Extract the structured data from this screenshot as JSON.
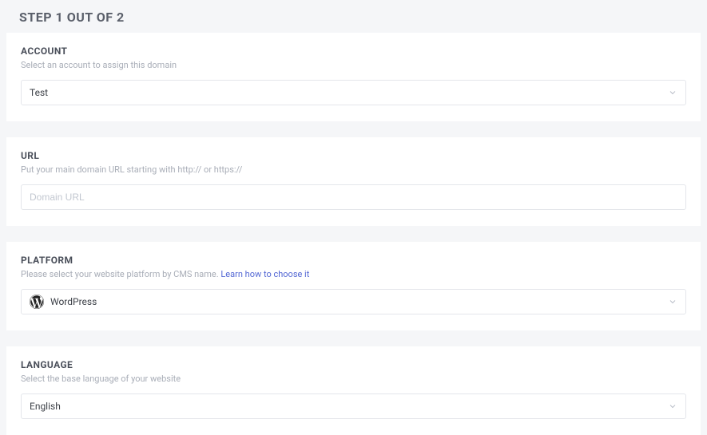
{
  "page": {
    "title": "STEP 1 OUT OF 2"
  },
  "account": {
    "title": "ACCOUNT",
    "subtitle": "Select an account to assign this domain",
    "selected": "Test"
  },
  "url": {
    "title": "URL",
    "subtitle": "Put your main domain URL starting with http:// or https://",
    "placeholder": "Domain URL",
    "value": ""
  },
  "platform": {
    "title": "PLATFORM",
    "subtitle_prefix": "Please select your website platform by CMS name. ",
    "learn_link": "Learn how to choose it",
    "selected": "WordPress"
  },
  "language": {
    "title": "LANGUAGE",
    "subtitle": "Select the base language of your website",
    "selected": "English"
  }
}
